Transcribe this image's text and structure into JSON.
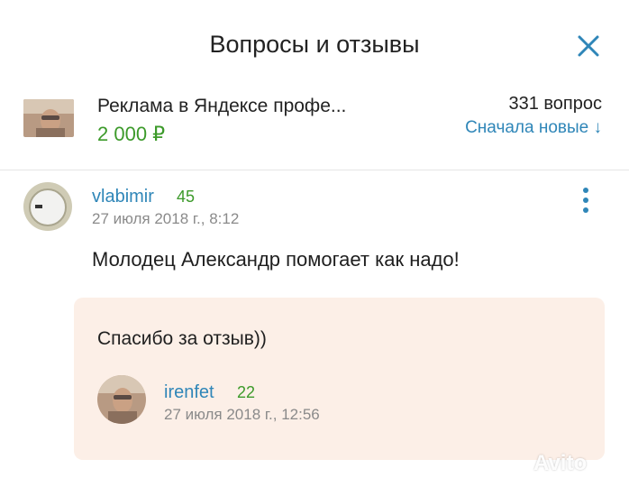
{
  "header": {
    "title": "Вопросы и отзывы"
  },
  "product": {
    "title": "Реклама в Яндексе профе...",
    "price": "2 000 ₽",
    "question_count": "331 вопрос",
    "sort_label": "Сначала новые ↓"
  },
  "review": {
    "username": "vlabimir",
    "rating": "45",
    "date": "27 июля 2018 г., 8:12",
    "text": "Молодец Александр помогает как надо!"
  },
  "reply": {
    "text": "Спасибо за отзыв))",
    "username": "irenfet",
    "rating": "22",
    "date": "27 июля 2018 г., 12:56"
  },
  "watermark": "Avito",
  "colors": {
    "link": "#2f86b8",
    "price_green": "#3c9a2a",
    "reply_bg": "#fcefe7"
  }
}
